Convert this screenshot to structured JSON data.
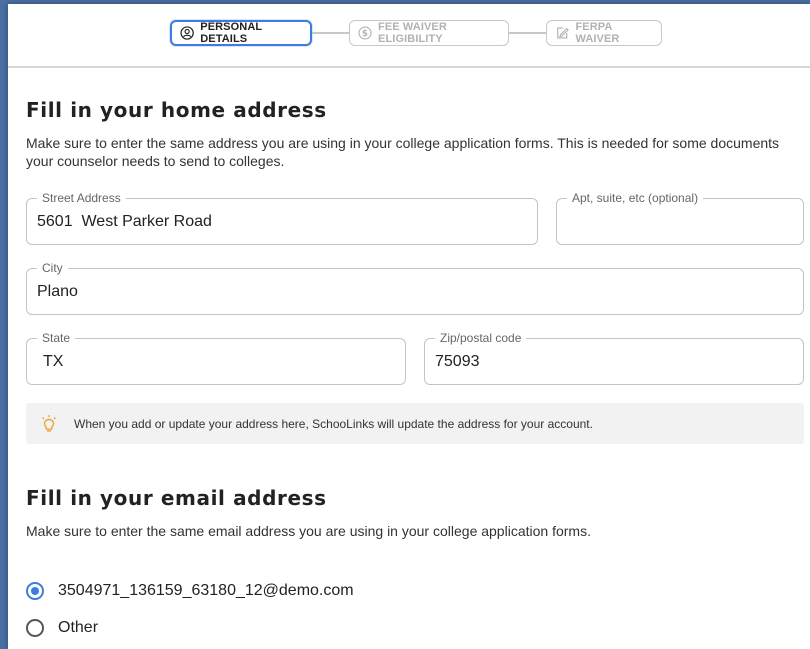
{
  "stepper": {
    "steps": [
      {
        "label": "PERSONAL DETAILS",
        "icon": "user-circle-icon",
        "state": "active"
      },
      {
        "label": "FEE WAIVER ELIGIBILITY",
        "icon": "dollar-circle-icon",
        "state": "inactive"
      },
      {
        "label": "FERPA WAIVER",
        "icon": "signature-icon",
        "state": "inactive"
      }
    ]
  },
  "address": {
    "title": "Fill in your home address",
    "description": "Make sure to enter the same address you are using in your college application forms. This is needed for some documents your counselor needs to send to colleges.",
    "street": {
      "label": "Street Address",
      "value": "5601  West Parker Road"
    },
    "apt": {
      "label": "Apt, suite, etc (optional)",
      "value": ""
    },
    "city": {
      "label": "City",
      "value": "Plano"
    },
    "state": {
      "label": "State",
      "value": "TX"
    },
    "zip": {
      "label": "Zip/postal code",
      "value": "75093"
    },
    "notice": "When you add or update your address here, SchooLinks will update the address for your account.",
    "notice_icon": "lightbulb-icon"
  },
  "email": {
    "title": "Fill in your email address",
    "description": "Make sure to enter the same email address you are using in your college application forms.",
    "options": [
      {
        "label": "3504971_136159_63180_12@demo.com",
        "checked": true
      },
      {
        "label": "Other",
        "checked": false
      }
    ]
  },
  "colors": {
    "accent": "#3b7ddd",
    "notice_bg": "#f2f2f2",
    "bulb": "#f0a340"
  }
}
